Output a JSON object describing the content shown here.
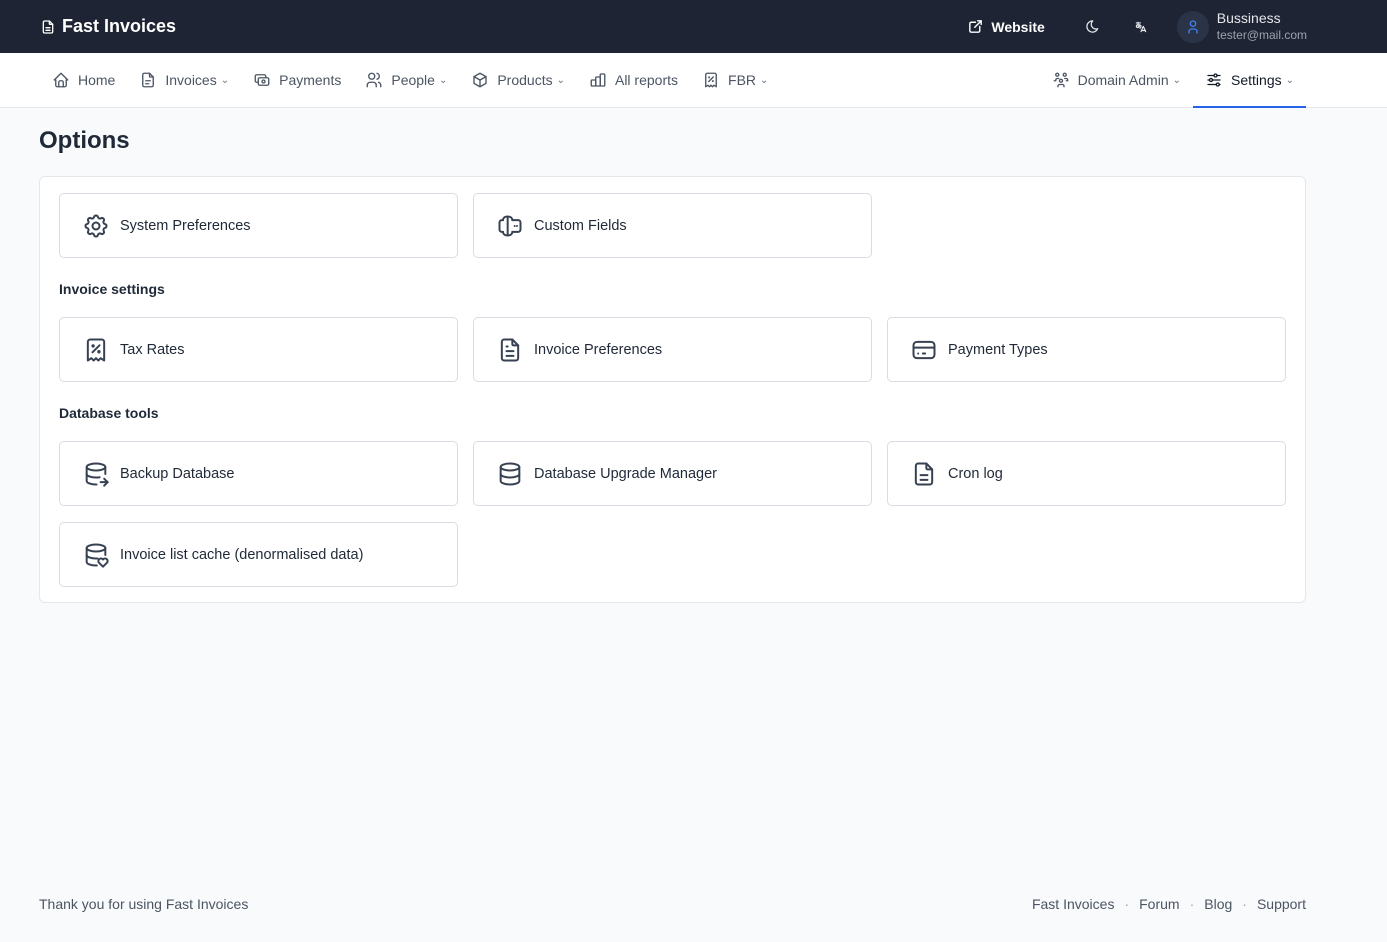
{
  "brand": {
    "name": "Fast Invoices",
    "icon": "document-icon"
  },
  "topbar": {
    "website_label": "Website",
    "user": {
      "name": "Bussiness",
      "email": "tester@mail.com"
    }
  },
  "nav": {
    "left": [
      {
        "label": "Home",
        "icon": "home-icon"
      },
      {
        "label": "Invoices",
        "icon": "invoice-icon",
        "dropdown": true
      },
      {
        "label": "Payments",
        "icon": "payments-icon"
      },
      {
        "label": "People",
        "icon": "people-icon",
        "dropdown": true
      },
      {
        "label": "Products",
        "icon": "box-icon",
        "dropdown": true
      },
      {
        "label": "All reports",
        "icon": "chart-icon"
      },
      {
        "label": "FBR",
        "icon": "receipt-tax-icon",
        "dropdown": true
      }
    ],
    "right": [
      {
        "label": "Domain Admin",
        "icon": "users-group-icon",
        "dropdown": true
      },
      {
        "label": "Settings",
        "icon": "sliders-icon",
        "dropdown": true,
        "active": true
      }
    ],
    "accent_color": "#2563eb"
  },
  "page": {
    "title": "Options"
  },
  "general_cards": [
    {
      "label": "System Preferences",
      "icon": "gear-icon"
    },
    {
      "label": "Custom Fields",
      "icon": "text-field-icon"
    }
  ],
  "sections": {
    "invoice_settings": {
      "title": "Invoice settings",
      "cards": [
        {
          "label": "Tax Rates",
          "icon": "receipt-tax-icon"
        },
        {
          "label": "Invoice Preferences",
          "icon": "file-text-icon"
        },
        {
          "label": "Payment Types",
          "icon": "credit-card-icon"
        }
      ]
    },
    "database_tools": {
      "title": "Database tools",
      "cards": [
        {
          "label": "Backup Database",
          "icon": "database-export-icon"
        },
        {
          "label": "Database Upgrade Manager",
          "icon": "database-icon"
        },
        {
          "label": "Cron log",
          "icon": "file-text-icon"
        },
        {
          "label": "Invoice list cache (denormalised data)",
          "icon": "database-heart-icon"
        }
      ]
    }
  },
  "footer": {
    "text": "Thank you for using Fast Invoices",
    "links": [
      "Fast Invoices",
      "Forum",
      "Blog",
      "Support"
    ],
    "separator": "·"
  }
}
